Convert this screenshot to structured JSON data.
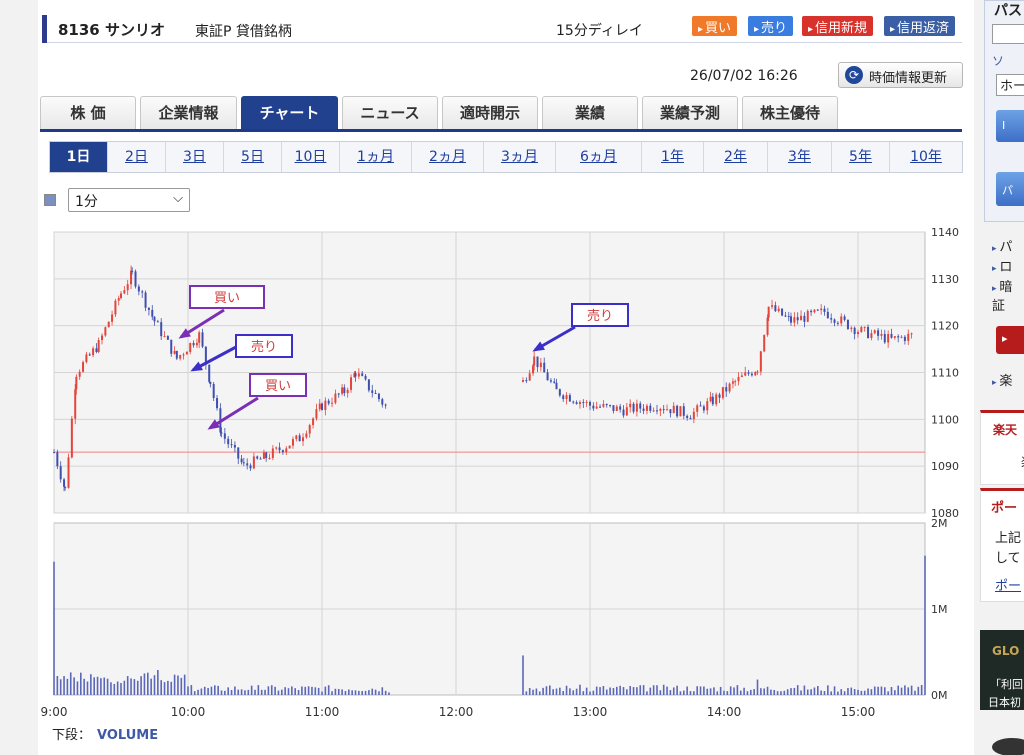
{
  "header": {
    "stock": "8136 サンリオ",
    "market": "東証P 貸借銘柄",
    "delay": "15分ディレイ",
    "buttons": {
      "buy": "買い",
      "sell": "売り",
      "margin_new": "信用新規",
      "margin_repay": "信用返済"
    },
    "timestamp": "26/07/02 16:26",
    "refresh": "時価情報更新"
  },
  "tabs": [
    "株 価",
    "企業情報",
    "チャート",
    "ニュース",
    "適時開示",
    "業績",
    "業績予測",
    "株主優待"
  ],
  "active_tab": "チャート",
  "periods": [
    "1日",
    "2日",
    "3日",
    "5日",
    "10日",
    "1ヵ月",
    "2ヵ月",
    "3ヵ月",
    "6ヵ月",
    "1年",
    "2年",
    "3年",
    "5年",
    "10年"
  ],
  "active_period": "1日",
  "interval": {
    "selected": "1分"
  },
  "chart": {
    "annotations": [
      {
        "text": "買い",
        "type": "buy"
      },
      {
        "text": "売り",
        "type": "sell"
      },
      {
        "text": "買い",
        "type": "buy"
      },
      {
        "text": "売り",
        "type": "sell"
      }
    ],
    "lower_label": "下段：",
    "lower_indicator": "VOLUME",
    "colors": {
      "up": "#e4443a",
      "down": "#3f4fb0",
      "ref": "#f08080",
      "annot_purple": "#7a2fb5",
      "annot_blue": "#3b2fc8",
      "volume": "#5b67b8"
    }
  },
  "chart_data": {
    "type": "candlestick",
    "x_ticks": [
      "9:00",
      "10:00",
      "11:00",
      "12:00",
      "13:00",
      "14:00",
      "15:00"
    ],
    "price_ticks": [
      "1140",
      "1130",
      "1120",
      "1110",
      "1100",
      "1090",
      "1080"
    ],
    "volume_ticks": [
      "2M",
      "1M",
      "0M"
    ],
    "ylim": [
      1080,
      1140
    ],
    "reference_price": 1093,
    "price_series": [
      {
        "t": "9:00",
        "price": 1093
      },
      {
        "t": "9:05",
        "price": 1085
      },
      {
        "t": "9:10",
        "price": 1110
      },
      {
        "t": "9:20",
        "price": 1116
      },
      {
        "t": "9:30",
        "price": 1127
      },
      {
        "t": "9:35",
        "price": 1131
      },
      {
        "t": "9:45",
        "price": 1121
      },
      {
        "t": "9:55",
        "price": 1113
      },
      {
        "t": "10:05",
        "price": 1118
      },
      {
        "t": "10:10",
        "price": 1108
      },
      {
        "t": "10:15",
        "price": 1097
      },
      {
        "t": "10:25",
        "price": 1090
      },
      {
        "t": "10:35",
        "price": 1092
      },
      {
        "t": "10:50",
        "price": 1096
      },
      {
        "t": "11:00",
        "price": 1103
      },
      {
        "t": "11:10",
        "price": 1106
      },
      {
        "t": "11:15",
        "price": 1110
      },
      {
        "t": "11:30",
        "price": 1102
      },
      {
        "t": "12:30",
        "price": 1108
      },
      {
        "t": "12:35",
        "price": 1113
      },
      {
        "t": "12:45",
        "price": 1106
      },
      {
        "t": "13:00",
        "price": 1103
      },
      {
        "t": "13:15",
        "price": 1102
      },
      {
        "t": "13:30",
        "price": 1103
      },
      {
        "t": "13:45",
        "price": 1101
      },
      {
        "t": "13:55",
        "price": 1104
      },
      {
        "t": "14:05",
        "price": 1108
      },
      {
        "t": "14:15",
        "price": 1111
      },
      {
        "t": "14:20",
        "price": 1124
      },
      {
        "t": "14:30",
        "price": 1121
      },
      {
        "t": "14:45",
        "price": 1123
      },
      {
        "t": "15:00",
        "price": 1119
      },
      {
        "t": "15:15",
        "price": 1117
      },
      {
        "t": "15:25",
        "price": 1118
      }
    ],
    "volume_series": [
      {
        "t": "9:00",
        "v": 1.55
      },
      {
        "t": "9:05",
        "v": 0.22
      },
      {
        "t": "9:30",
        "v": 0.14
      },
      {
        "t": "10:00",
        "v": 0.1
      },
      {
        "t": "10:30",
        "v": 0.06
      },
      {
        "t": "11:00",
        "v": 0.04
      },
      {
        "t": "11:30",
        "v": 0.03
      },
      {
        "t": "12:30",
        "v": 0.46
      },
      {
        "t": "13:00",
        "v": 0.04
      },
      {
        "t": "14:00",
        "v": 0.05
      },
      {
        "t": "14:15",
        "v": 0.18
      },
      {
        "t": "14:30",
        "v": 0.08
      },
      {
        "t": "15:00",
        "v": 0.06
      },
      {
        "t": "15:30",
        "v": 1.62
      }
    ]
  },
  "sidebar": {
    "title": "パス",
    "keyboard": "ソ",
    "select": "ホー",
    "btn1": "I",
    "btn2": "パ",
    "links": [
      "パ",
      "ロ",
      "暗証"
    ],
    "link2": "楽",
    "box2_title": "楽天",
    "box2_body": "楽",
    "box3_title": "ポー",
    "box3_l1": "上記",
    "box3_l2": "して",
    "box3_link": "ポー",
    "ad1": "GLO",
    "ad2": "「利回",
    "ad3": "日本初"
  }
}
